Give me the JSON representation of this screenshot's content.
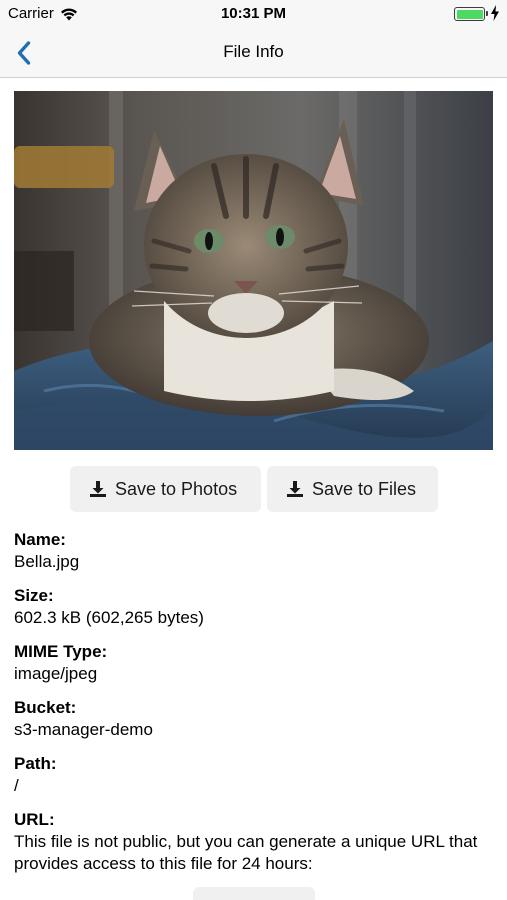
{
  "status_bar": {
    "carrier": "Carrier",
    "time": "10:31 PM",
    "battery_level": 1.0,
    "charging": true
  },
  "nav": {
    "title": "File Info",
    "back_icon": "chevron-left-icon"
  },
  "colors": {
    "accent": "#1f6fb2",
    "button_bg": "#f0f0f0",
    "battery_green": "#4cd964"
  },
  "actions": {
    "save_to_photos": "Save to Photos",
    "save_to_files": "Save to Files",
    "icon": "download-icon"
  },
  "file": {
    "name_label": "Name:",
    "name": "Bella.jpg",
    "size_label": "Size:",
    "size": "602.3 kB (602,265 bytes)",
    "mime_label": "MIME Type:",
    "mime": "image/jpeg",
    "bucket_label": "Bucket:",
    "bucket": "s3-manager-demo",
    "path_label": "Path:",
    "path": "/",
    "url_label": "URL:",
    "url_note": "This file is not public, but you can generate a unique URL that provides access to this file for 24 hours:"
  }
}
